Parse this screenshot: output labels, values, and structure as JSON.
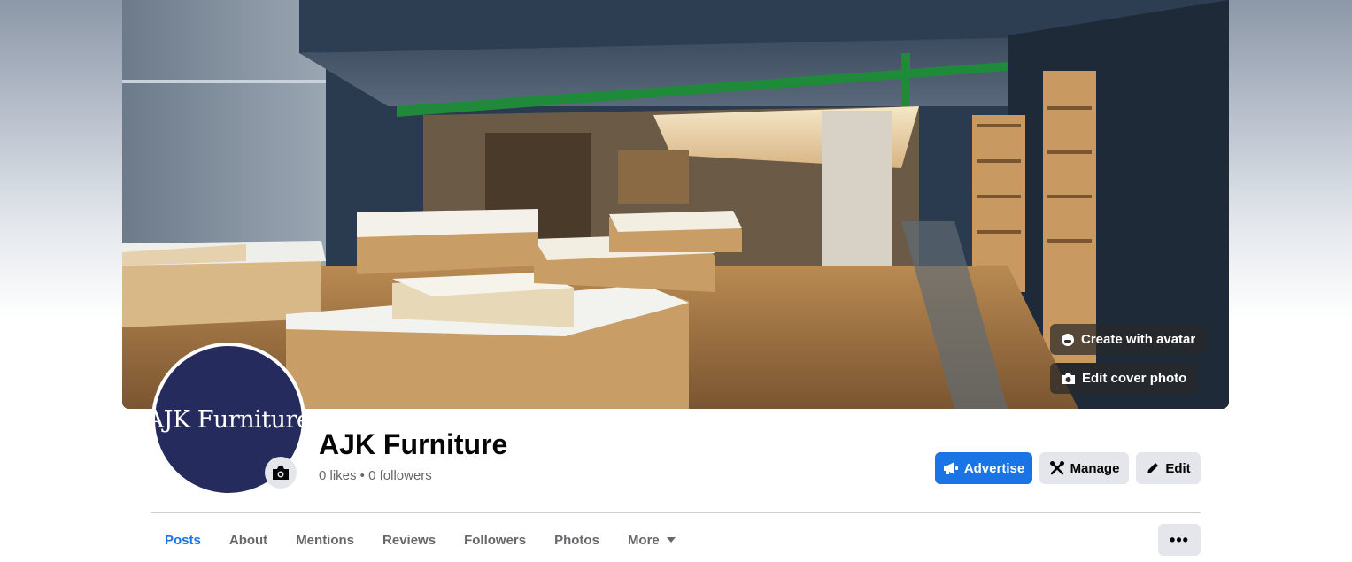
{
  "cover": {
    "create_avatar_label": "Create with avatar",
    "edit_cover_label": "Edit cover photo"
  },
  "profile": {
    "avatar_text": "AJK Furniture",
    "name": "AJK Furniture",
    "stats": "0 likes • 0 followers"
  },
  "actions": {
    "advertise_label": "Advertise",
    "manage_label": "Manage",
    "edit_label": "Edit"
  },
  "tabs": [
    {
      "label": "Posts",
      "active": true
    },
    {
      "label": "About",
      "active": false
    },
    {
      "label": "Mentions",
      "active": false
    },
    {
      "label": "Reviews",
      "active": false
    },
    {
      "label": "Followers",
      "active": false
    },
    {
      "label": "Photos",
      "active": false
    },
    {
      "label": "More",
      "active": false,
      "icon": "caret-down-icon"
    }
  ],
  "more_menu_label": "•••",
  "colors": {
    "accent": "#1b74e4",
    "avatar_bg": "#262b5e",
    "secondary_text": "#65676b",
    "button_gray": "#e4e6eb"
  },
  "icons": [
    "avatar-face-icon",
    "camera-icon",
    "megaphone-icon",
    "tools-icon",
    "pencil-icon",
    "caret-down-icon",
    "more-dots-icon"
  ]
}
